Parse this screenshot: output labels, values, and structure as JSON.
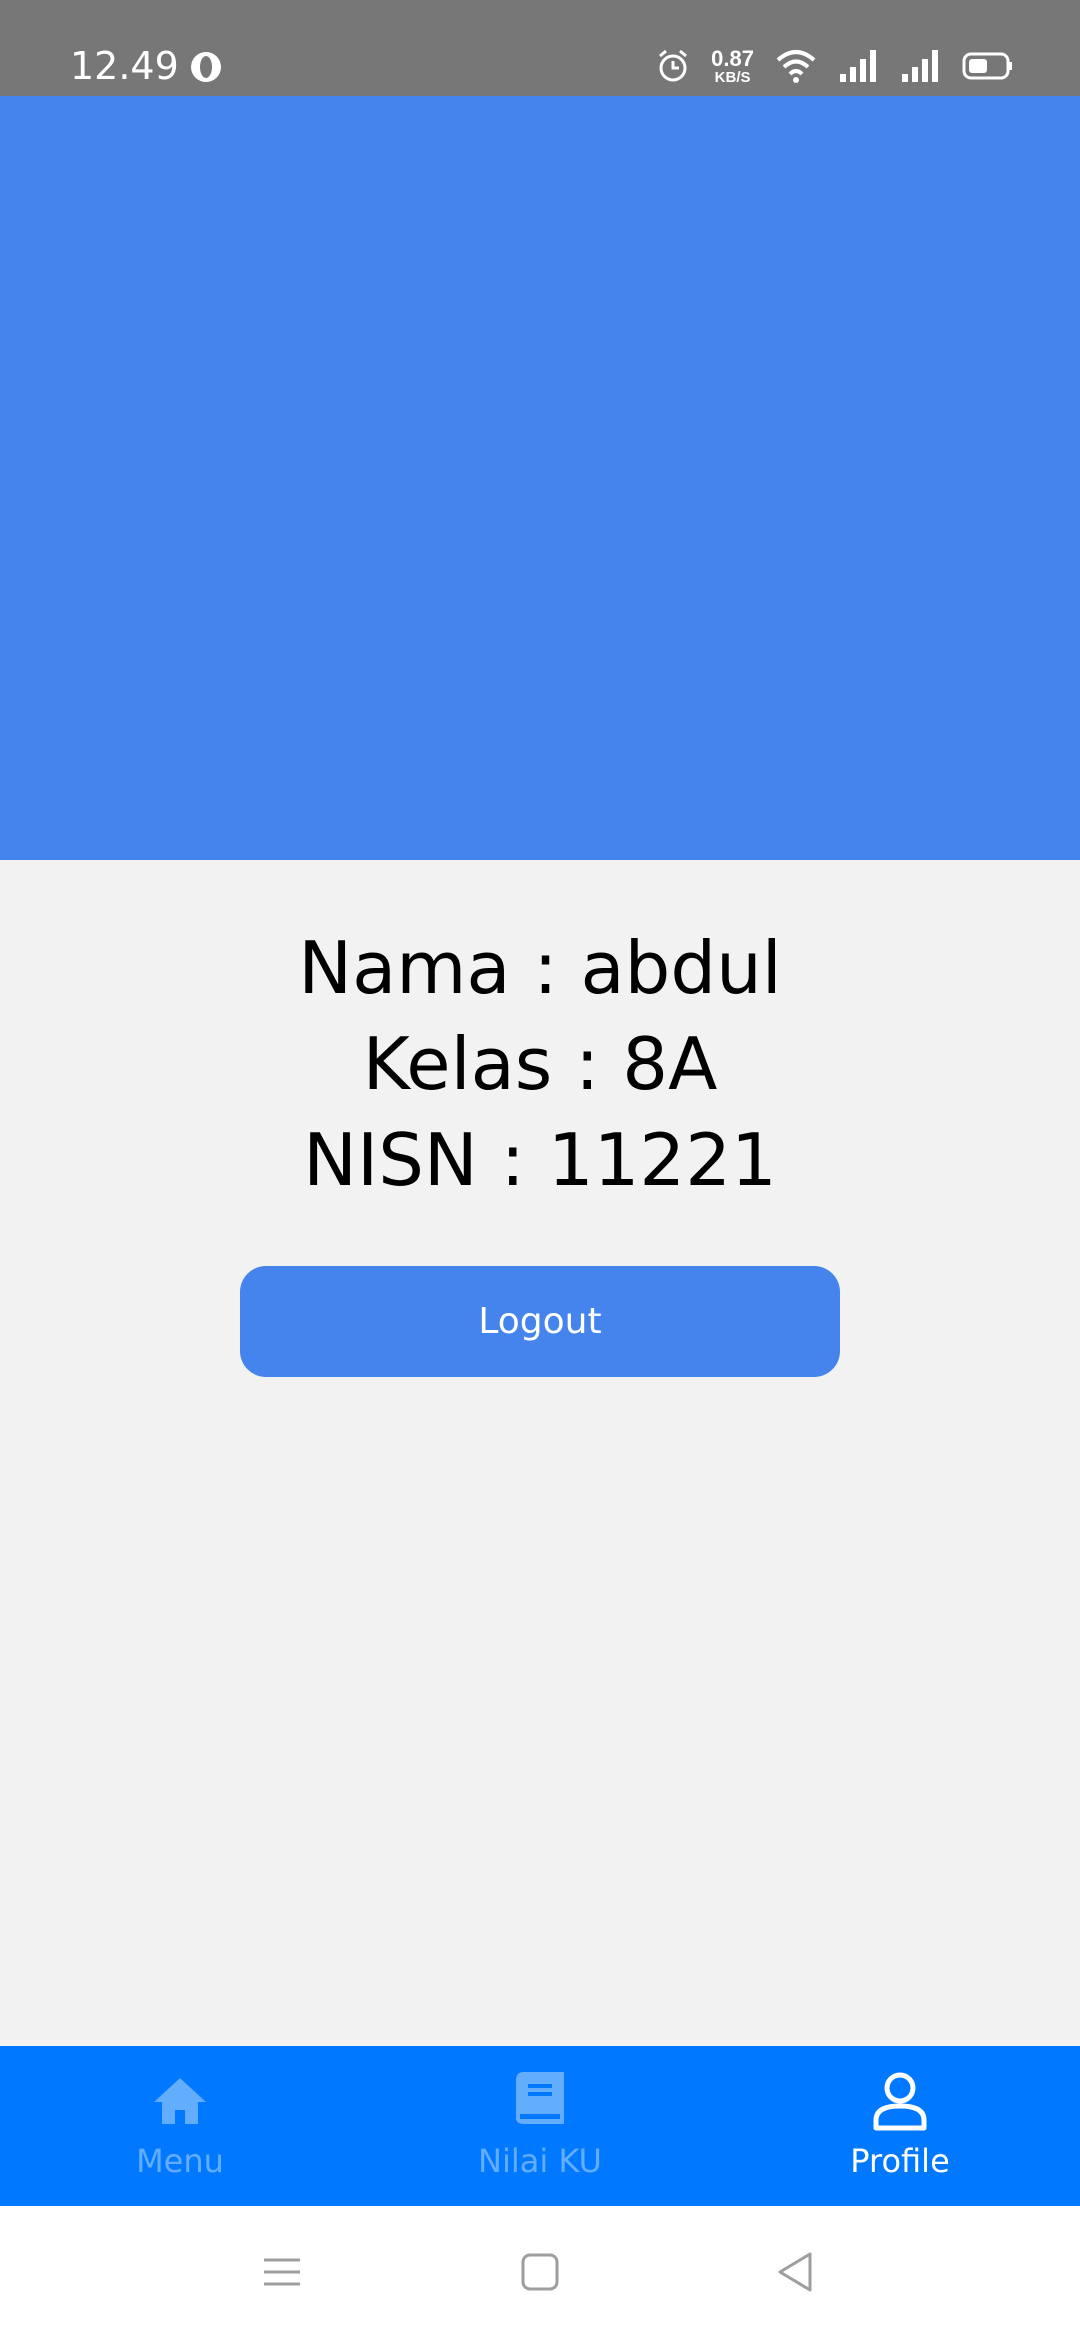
{
  "status_bar": {
    "time": "12.49",
    "net_speed_value": "0.87",
    "net_speed_unit": "KB/S",
    "icons": [
      "opera-icon",
      "alarm-icon",
      "wifi-icon",
      "signal-icon",
      "signal-icon",
      "battery-icon"
    ]
  },
  "colors": {
    "status_bar": "#777777",
    "banner": "#4584ed",
    "background": "#f2f2f2",
    "button": "#4584ed",
    "bottom_nav": "#0078ff",
    "nav_inactive": "#63adff",
    "nav_active": "#ffffff"
  },
  "profile": {
    "name_line": "Nama : abdul",
    "class_line": "Kelas : 8A",
    "nisn_line": "NISN : 11221"
  },
  "logout_button": {
    "label": "Logout"
  },
  "bottom_nav": {
    "items": [
      {
        "label": "Menu",
        "icon": "home-icon",
        "active": false
      },
      {
        "label": "Nilai KU",
        "icon": "book-icon",
        "active": false
      },
      {
        "label": "Profile",
        "icon": "person-icon",
        "active": true
      }
    ]
  },
  "system_nav": {
    "icons": [
      "recents-icon",
      "home-square-icon",
      "back-icon"
    ]
  }
}
